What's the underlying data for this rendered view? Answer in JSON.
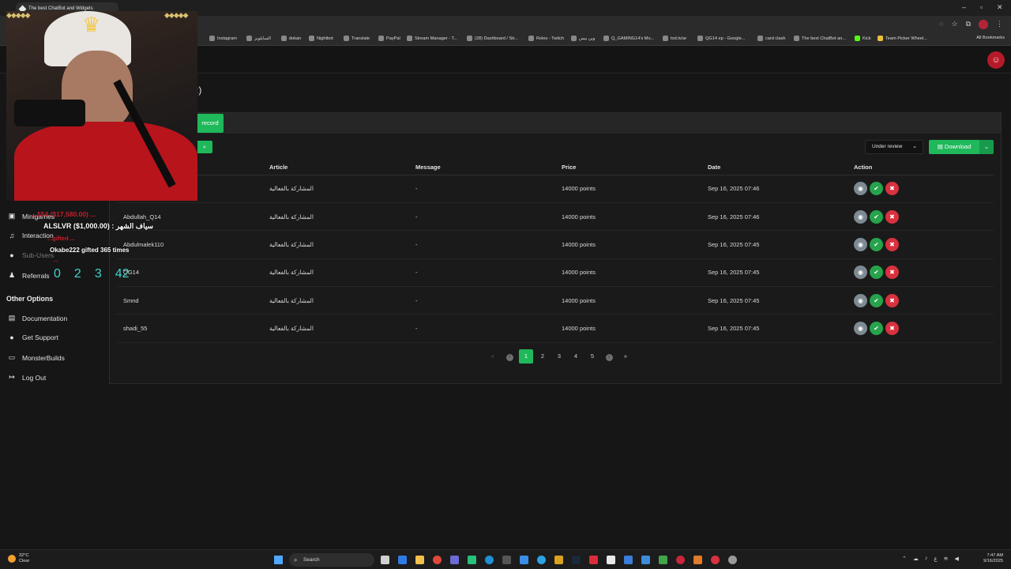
{
  "browser": {
    "tab_title": "The best ChatBot and Widgets",
    "bookmarks": [
      "Instagram",
      "السايلويز",
      "dokan",
      "Nightbot",
      "Translate",
      "PayPal",
      "Stream Manager - T...",
      "(28) Dashboard / Str...",
      "Roles - Twitch",
      "وين بيس",
      "Q_GAMING14's Mo...",
      "tod.tv/ar",
      "QG14 ep - Google...",
      "card clash",
      "The best ChatBot an...",
      "Kick",
      "Team Picker Wheel..."
    ],
    "all_bookmarks": "All Bookmarks"
  },
  "page": {
    "title_suffix": ":)"
  },
  "sidebar": {
    "items": [
      {
        "label": "Minigames",
        "icon": "gamepad-icon"
      },
      {
        "label": "Interaction",
        "icon": "music-icon"
      },
      {
        "label": "Sub-Users",
        "icon": "users-icon"
      },
      {
        "label": "Referrals",
        "icon": "referrals-icon"
      }
    ],
    "other_heading": "Other Options",
    "other_items": [
      {
        "label": "Documentation",
        "icon": "book-icon"
      },
      {
        "label": "Get Support",
        "icon": "support-icon"
      },
      {
        "label": "MonsterBuilds",
        "icon": "laptop-icon"
      },
      {
        "label": "Log Out",
        "icon": "logout-icon"
      }
    ]
  },
  "toolbar": {
    "record_label": "record",
    "status_value": "Under review",
    "download_label": "Download"
  },
  "table": {
    "headers": [
      "Article",
      "Message",
      "Price",
      "Date",
      "Action"
    ],
    "rows": [
      {
        "user": "",
        "article": "المشاركة بالفعالية",
        "message": "-",
        "price": "14000 points",
        "date": "Sep 16, 2025 07:46"
      },
      {
        "user": "Abdullah_Q14",
        "article": "المشاركة بالفعالية",
        "message": "-",
        "price": "14000 points",
        "date": "Sep 16, 2025 07:46"
      },
      {
        "user": "Abdulmalek110",
        "article": "المشاركة بالفعالية",
        "message": "-",
        "price": "14000 points",
        "date": "Sep 16, 2025 07:45"
      },
      {
        "user": "QG14",
        "article": "المشاركة بالفعالية",
        "message": "-",
        "price": "14000 points",
        "date": "Sep 16, 2025 07:45"
      },
      {
        "user": "Smnd",
        "article": "المشاركة بالفعالية",
        "message": "-",
        "price": "14000 points",
        "date": "Sep 16, 2025 07:45"
      },
      {
        "user": "shadi_55",
        "article": "المشاركة بالفعالية",
        "message": "-",
        "price": "14000 points",
        "date": "Sep 16, 2025 07:45"
      }
    ]
  },
  "pagination": {
    "first": "«",
    "prev": "‹",
    "pages": [
      "1",
      "2",
      "3",
      "4",
      "5"
    ],
    "current": "1",
    "next": "›",
    "last": "»"
  },
  "overlay": {
    "top_line": "...554 ($17,580.00) ...",
    "goal_line": "ALSLVR ($1,000.00) : سياف الشهر",
    "mid_line": "...gifted ...",
    "gift_line": "Okabe222 gifted 365 times",
    "bottom_line": "...",
    "countdown": [
      "0",
      "2",
      "3",
      "42"
    ]
  },
  "taskbar": {
    "temperature": "32°C",
    "weather": "Clear",
    "search_placeholder": "Search",
    "time": "7:47 AM",
    "date": "9/16/2025"
  },
  "colors": {
    "accent": "#1fb85a",
    "danger": "#d8313f",
    "view": "#7d8a91",
    "brand": "#b51a2a"
  }
}
